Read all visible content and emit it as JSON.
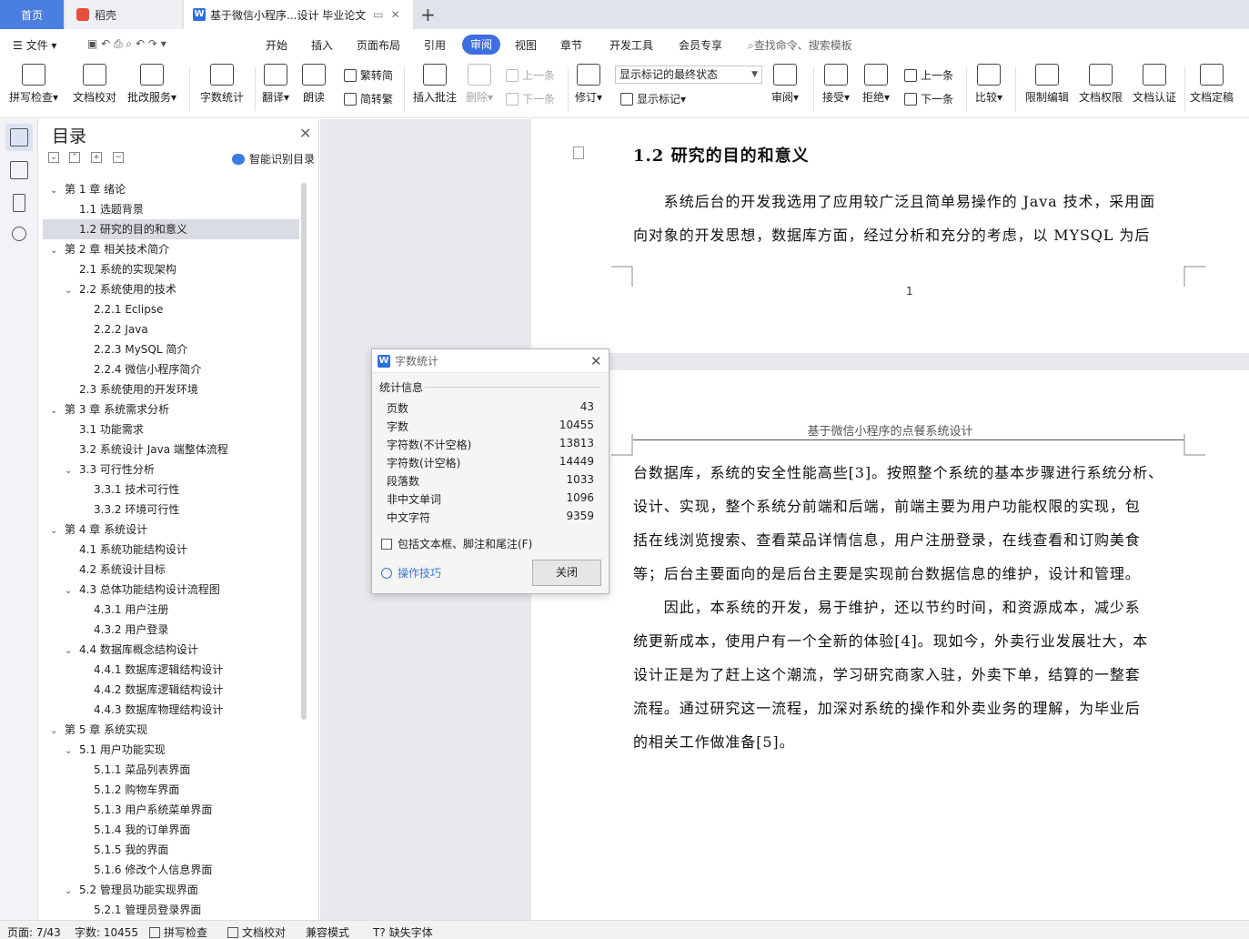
{
  "tabs": {
    "home": "首页",
    "daoke": "稻壳",
    "document": "基于微信小程序...设计 毕业论文"
  },
  "menu": {
    "items": [
      "文件",
      "开始",
      "插入",
      "页面布局",
      "引用",
      "审阅",
      "视图",
      "章节",
      "开发工具",
      "会员专享"
    ],
    "active": "审阅",
    "search_placeholder": "查找命令、搜索模板"
  },
  "toolbar": {
    "spell_check": "拼写检查",
    "doc_proof": "文档校对",
    "batch_service": "批改服务",
    "word_count": "字数统计",
    "translate": "翻译",
    "read_aloud": "朗读",
    "trad_conv": "繁转简",
    "simp_conv": "简转繁",
    "insert_comment": "插入批注",
    "delete": "删除",
    "prev_comment": "上一条",
    "next_comment": "下一条",
    "revise": "修订",
    "markup_select": "显示标记的最终状态",
    "show_markup": "显示标记",
    "review": "审阅",
    "accept": "接受",
    "reject": "拒绝",
    "prev_change": "上一条",
    "next_change": "下一条",
    "compare": "比较",
    "restrict_edit": "限制编辑",
    "doc_permission": "文档权限",
    "doc_certify": "文档认证",
    "doc_finalize": "文档定稿"
  },
  "toc": {
    "title": "目录",
    "smart_recognize": "智能识别目录",
    "items": [
      {
        "label": "第 1 章  绪论",
        "level": 0,
        "expand": true
      },
      {
        "label": "1.1  选题背景",
        "level": 1
      },
      {
        "label": "1.2  研究的目的和意义",
        "level": 1,
        "selected": true
      },
      {
        "label": "第 2 章  相关技术简介",
        "level": 0,
        "expand": true
      },
      {
        "label": "2.1  系统的实现架构",
        "level": 1
      },
      {
        "label": "2.2  系统使用的技术",
        "level": 1,
        "expand": true
      },
      {
        "label": "2.2.1 Eclipse",
        "level": 2
      },
      {
        "label": "2.2.2 Java",
        "level": 2
      },
      {
        "label": "2.2.3 MySQL 简介",
        "level": 2
      },
      {
        "label": "2.2.4  微信小程序简介",
        "level": 2
      },
      {
        "label": "2.3  系统使用的开发环境",
        "level": 1
      },
      {
        "label": "第 3 章  系统需求分析",
        "level": 0,
        "expand": true
      },
      {
        "label": "3.1  功能需求",
        "level": 1
      },
      {
        "label": "3.2 系统设计 Java 端整体流程",
        "level": 1
      },
      {
        "label": "3.3  可行性分析",
        "level": 1,
        "expand": true
      },
      {
        "label": "3.3.1 技术可行性",
        "level": 2
      },
      {
        "label": "3.3.2 环境可行性",
        "level": 2
      },
      {
        "label": "第 4 章  系统设计",
        "level": 0,
        "expand": true
      },
      {
        "label": "4.1 系统功能结构设计",
        "level": 1
      },
      {
        "label": "4.2 系统设计目标",
        "level": 1
      },
      {
        "label": "4.3 总体功能结构设计流程图",
        "level": 1,
        "expand": true
      },
      {
        "label": "4.3.1 用户注册",
        "level": 2
      },
      {
        "label": "4.3.2 用户登录",
        "level": 2
      },
      {
        "label": "4.4 数据库概念结构设计",
        "level": 1,
        "expand": true
      },
      {
        "label": "4.4.1 数据库逻辑结构设计",
        "level": 2
      },
      {
        "label": "4.4.2  数据库逻辑结构设计",
        "level": 2
      },
      {
        "label": "4.4.3  数据库物理结构设计",
        "level": 2
      },
      {
        "label": "第 5 章  系统实现",
        "level": 0,
        "expand": true
      },
      {
        "label": "5.1 用户功能实现",
        "level": 1,
        "expand": true
      },
      {
        "label": "5.1.1 菜品列表界面",
        "level": 2
      },
      {
        "label": "5.1.2 购物车界面",
        "level": 2
      },
      {
        "label": "5.1.3  用户系统菜单界面",
        "level": 2
      },
      {
        "label": "5.1.4  我的订单界面",
        "level": 2
      },
      {
        "label": "5.1.5  我的界面",
        "level": 2
      },
      {
        "label": "5.1.6  修改个人信息界面",
        "level": 2
      },
      {
        "label": "5.2 管理员功能实现界面",
        "level": 1,
        "expand": true
      },
      {
        "label": "5.2.1 管理员登录界面",
        "level": 2
      }
    ]
  },
  "document": {
    "heading": "1.2  研究的目的和意义",
    "page1_lines": [
      "　　系统后台的开发我选用了应用较广泛且简单易操作的 Java 技术，采用面",
      "向对象的开发思想，数据库方面，经过分析和充分的考虑，以 MYSQL 为后"
    ],
    "page_number": "1",
    "running_header": "基于微信小程序的点餐系统设计",
    "page2_lines": [
      "台数据库，系统的安全性能高些[3]。按照整个系统的基本步骤进行系统分析、",
      "设计、实现，整个系统分前端和后端，前端主要为用户功能权限的实现，包",
      "括在线浏览搜索、查看菜品详情信息，用户注册登录，在线查看和订购美食",
      "等；后台主要面向的是后台主要是实现前台数据信息的维护，设计和管理。",
      "　　因此，本系统的开发，易于维护，还以节约时间，和资源成本，减少系",
      "统更新成本，使用户有一个全新的体验[4]。现如今，外卖行业发展壮大，本",
      "设计正是为了赶上这个潮流，学习研究商家入驻，外卖下单，结算的一整套",
      "流程。通过研究这一流程，加深对系统的操作和外卖业务的理解，为毕业后",
      "的相关工作做准备[5]。"
    ]
  },
  "dialog": {
    "title": "字数统计",
    "section": "统计信息",
    "stats": [
      {
        "label": "页数",
        "value": "43"
      },
      {
        "label": "字数",
        "value": "10455"
      },
      {
        "label": "字符数(不计空格)",
        "value": "13813"
      },
      {
        "label": "字符数(计空格)",
        "value": "14449"
      },
      {
        "label": "段落数",
        "value": "1033"
      },
      {
        "label": "非中文单词",
        "value": "1096"
      },
      {
        "label": "中文字符",
        "value": "9359"
      }
    ],
    "include_checkbox": "包括文本框、脚注和尾注(F)",
    "tips": "操作技巧",
    "close_button": "关闭"
  },
  "status": {
    "page": "页面: 7/43",
    "words": "字数: 10455",
    "spell": "拼写检查",
    "proof": "文档校对",
    "compat": "兼容模式",
    "missing_font": "缺失字体"
  },
  "colors": {
    "accent": "#3d6fe0",
    "tab_home": "#4a7ee0"
  }
}
